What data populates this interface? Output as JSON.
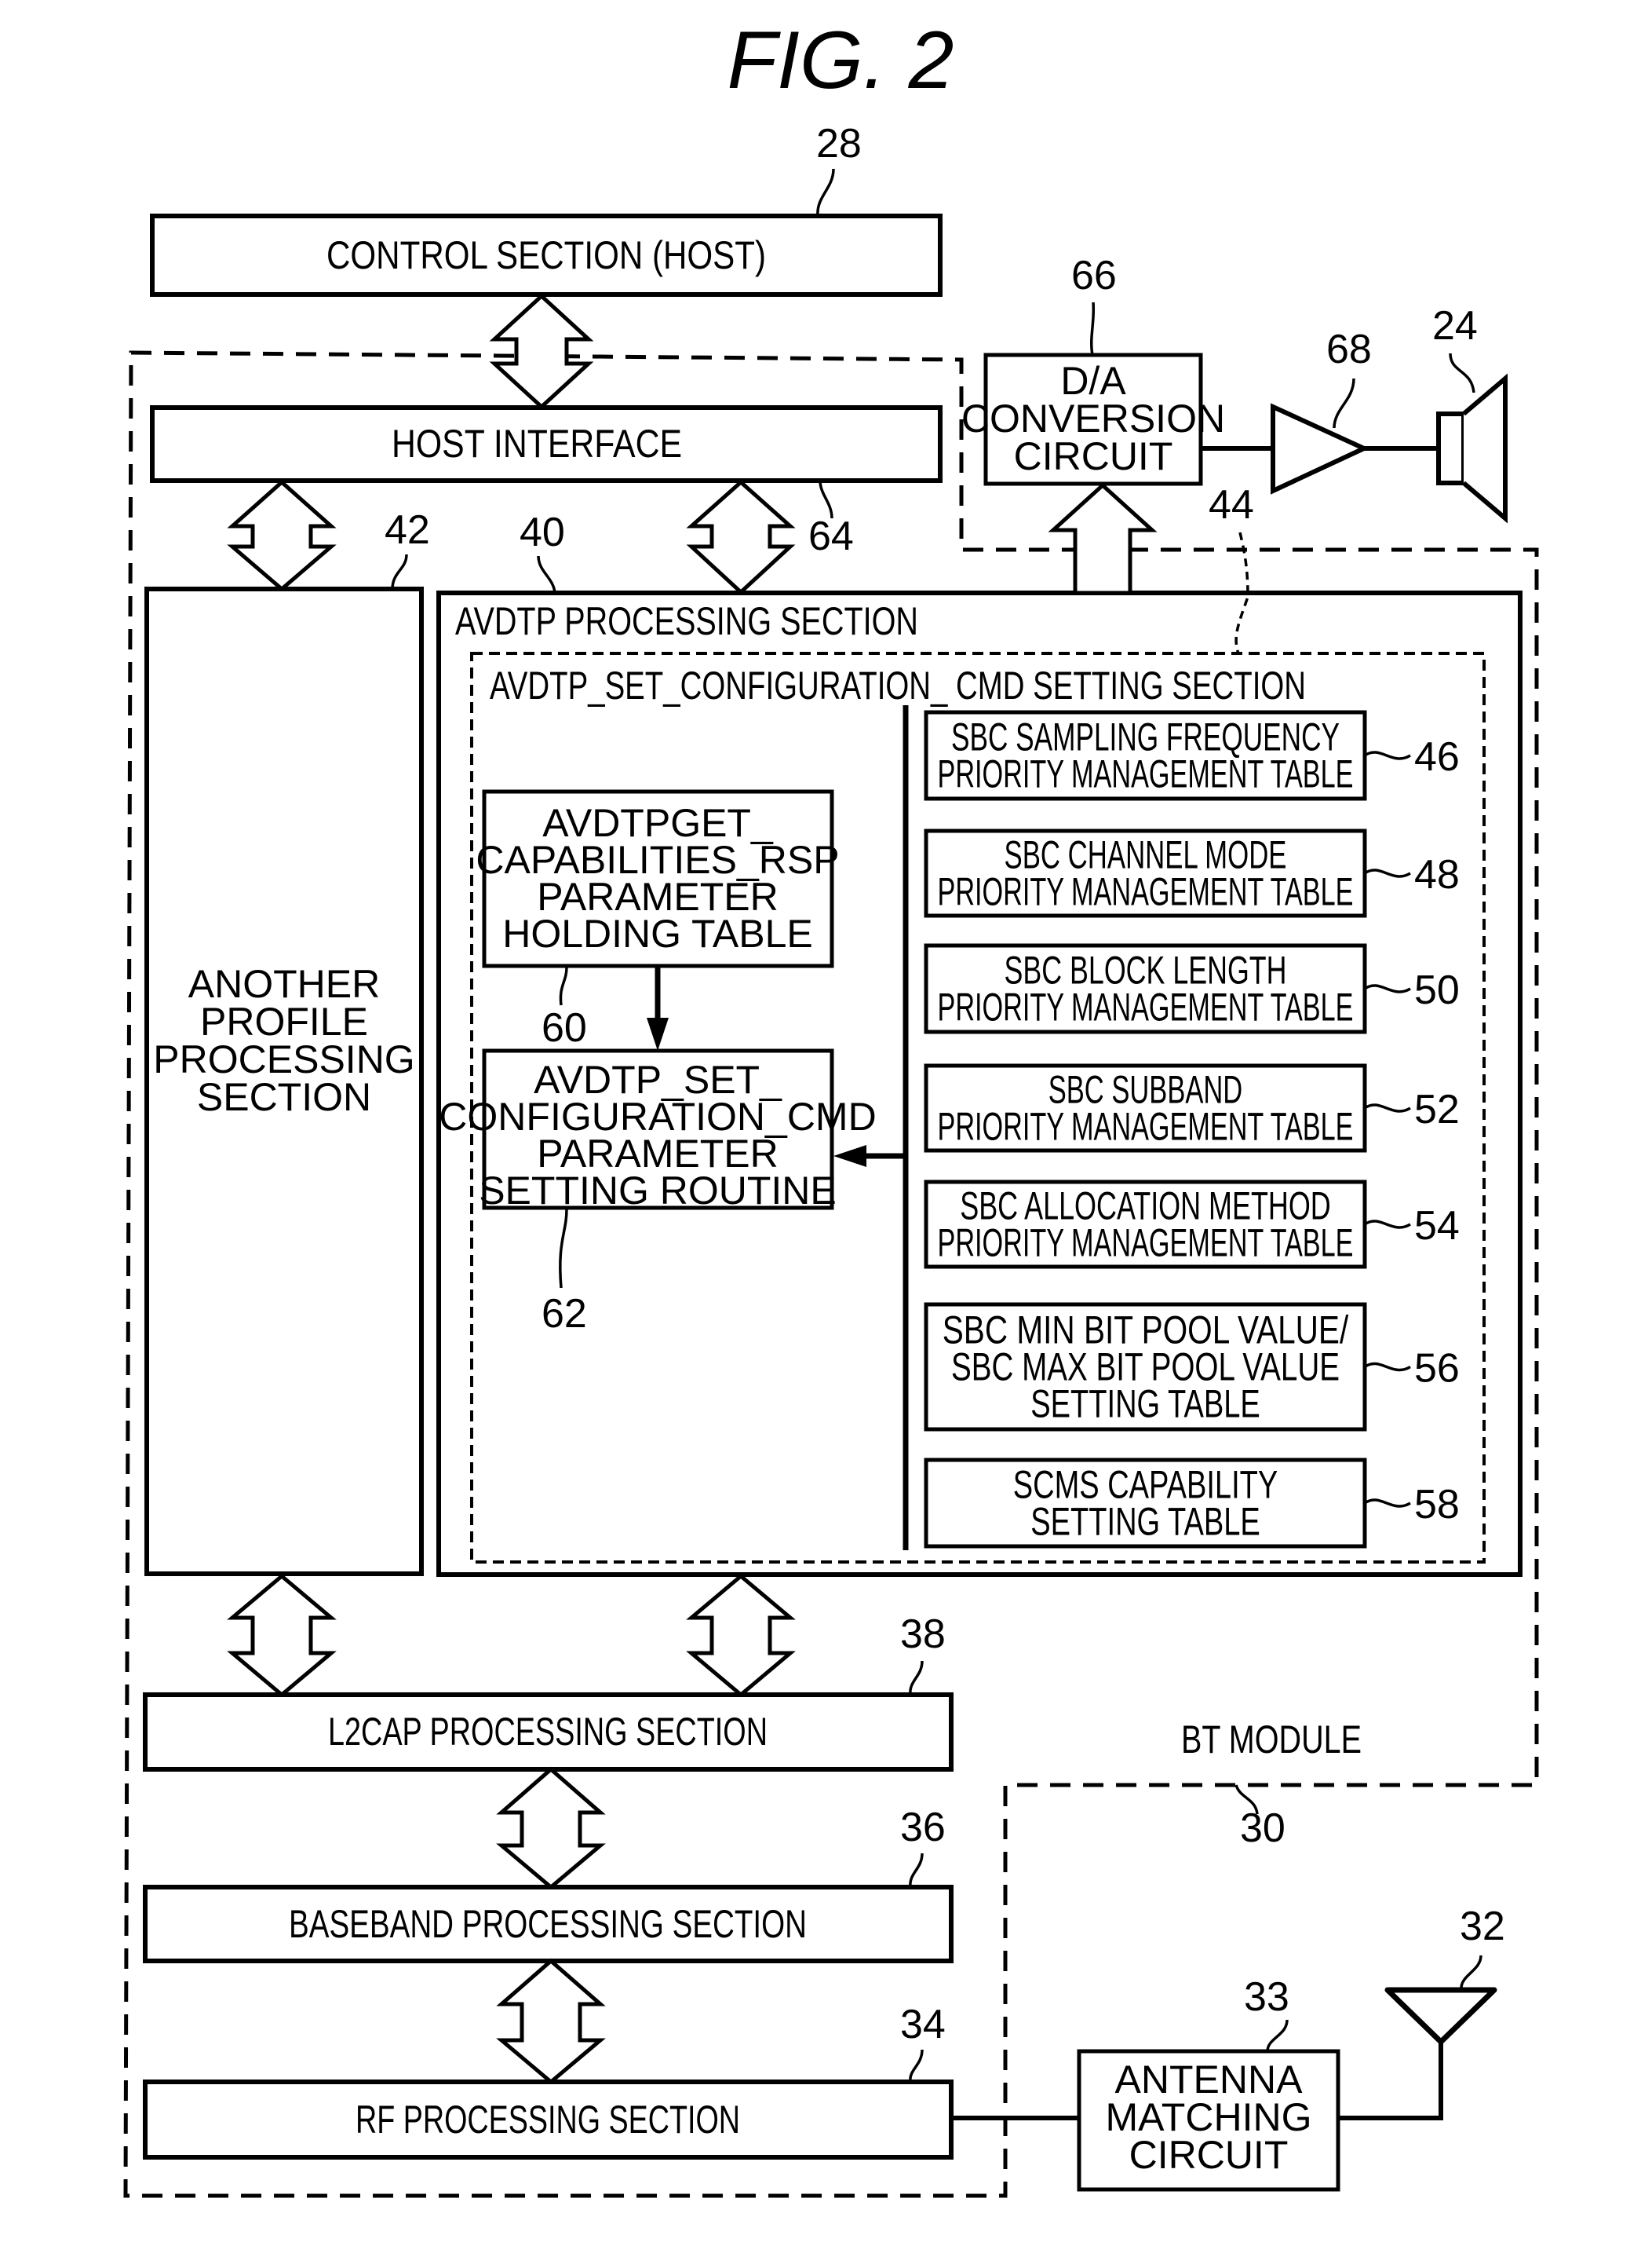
{
  "figure": {
    "title": "FIG. 2"
  },
  "blocks": {
    "control_section": {
      "label": "CONTROL SECTION (HOST)",
      "ref": "28"
    },
    "host_interface": {
      "label": "HOST INTERFACE",
      "ref": "64"
    },
    "another_profile": {
      "lines": [
        "ANOTHER",
        "PROFILE",
        "PROCESSING",
        "SECTION"
      ],
      "ref": "42"
    },
    "avdtp_processing": {
      "label": "AVDTP PROCESSING SECTION",
      "ref": "40"
    },
    "set_config_setting": {
      "label": "AVDTP_SET_CONFIGURATION_ CMD SETTING SECTION",
      "ref": "44"
    },
    "get_capabilities_table": {
      "lines": [
        "AVDTPGET_",
        "CAPABILITIES_RSP",
        "PARAMETER",
        "HOLDING TABLE"
      ],
      "ref": "60"
    },
    "set_config_routine": {
      "lines": [
        "AVDTP_SET_",
        "CONFIGURATION_CMD",
        "PARAMETER",
        "SETTING ROUTINE"
      ],
      "ref": "62"
    },
    "tables": [
      {
        "lines": [
          "SBC SAMPLING FREQUENCY",
          "PRIORITY MANAGEMENT TABLE"
        ],
        "ref": "46"
      },
      {
        "lines": [
          "SBC CHANNEL MODE",
          "PRIORITY MANAGEMENT TABLE"
        ],
        "ref": "48"
      },
      {
        "lines": [
          "SBC BLOCK LENGTH",
          "PRIORITY MANAGEMENT TABLE"
        ],
        "ref": "50"
      },
      {
        "lines": [
          "SBC SUBBAND",
          "PRIORITY MANAGEMENT TABLE"
        ],
        "ref": "52"
      },
      {
        "lines": [
          "SBC ALLOCATION METHOD",
          "PRIORITY MANAGEMENT TABLE"
        ],
        "ref": "54"
      },
      {
        "lines": [
          "SBC MIN BIT POOL VALUE/",
          "SBC MAX BIT POOL VALUE",
          "SETTING TABLE"
        ],
        "ref": "56"
      },
      {
        "lines": [
          "SCMS CAPABILITY",
          "SETTING TABLE"
        ],
        "ref": "58"
      }
    ],
    "da_conversion": {
      "lines": [
        "D/A",
        "CONVERSION",
        "CIRCUIT"
      ],
      "ref": "66"
    },
    "amplifier": {
      "ref": "68"
    },
    "speaker": {
      "ref": "24"
    },
    "l2cap": {
      "label": "L2CAP PROCESSING SECTION",
      "ref": "38"
    },
    "baseband": {
      "label": "BASEBAND PROCESSING SECTION",
      "ref": "36"
    },
    "rf": {
      "label": "RF PROCESSING SECTION",
      "ref": "34"
    },
    "bt_module": {
      "label": "BT MODULE",
      "ref": "30"
    },
    "antenna_matching": {
      "lines": [
        "ANTENNA",
        "MATCHING",
        "CIRCUIT"
      ],
      "ref": "33"
    },
    "antenna": {
      "ref": "32"
    }
  }
}
